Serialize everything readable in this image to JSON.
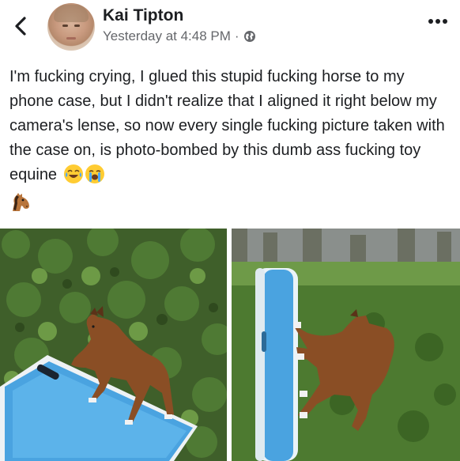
{
  "post": {
    "author": "Kai Tipton",
    "timestamp": "Yesterday at 4:48 PM",
    "separator": "·",
    "privacy_icon": "globe-icon",
    "more_icon": "more-horizontal-icon",
    "back_icon": "chevron-left-icon",
    "text": "I'm fucking crying, I glued this stupid fucking horse to my phone case, but I didn't realize that I aligned it right below my camera's lense, so now every single fucking picture taken with the case on, is photo-bombed by this dumb ass fucking toy equine",
    "emojis": [
      "face-with-tears-of-joy",
      "loudly-crying-face",
      "horse-face"
    ]
  },
  "photos": [
    {
      "icon": "photo-horse-on-phone-case"
    },
    {
      "icon": "photo-horse-photobomb"
    }
  ]
}
